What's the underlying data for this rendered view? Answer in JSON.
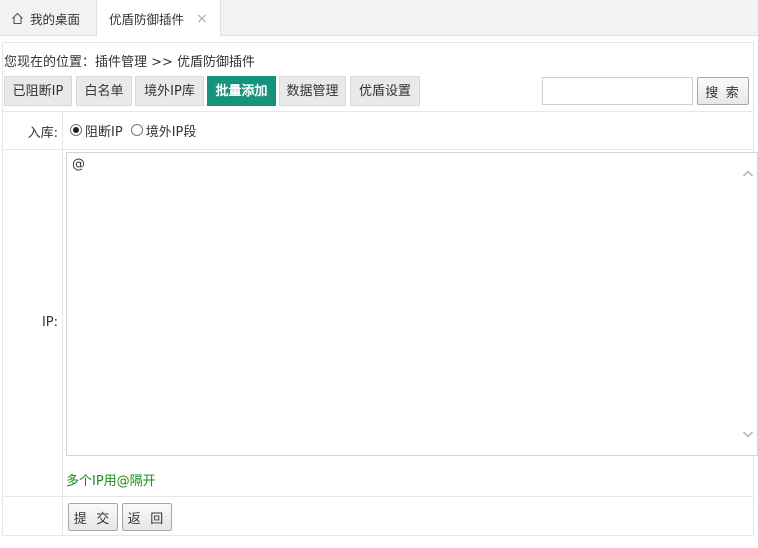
{
  "tabs": [
    {
      "label": "我的桌面",
      "icon": "home-icon"
    },
    {
      "label": "优盾防御插件",
      "close": "×"
    }
  ],
  "breadcrumb": "您现在的位置：插件管理 >> 优盾防御插件",
  "toolbar": {
    "buttons": [
      {
        "label": "已阻断IP"
      },
      {
        "label": "白名单"
      },
      {
        "label": "境外IP库"
      },
      {
        "label": "批量添加",
        "active": true
      },
      {
        "label": "数据管理"
      },
      {
        "label": "优盾设置"
      }
    ],
    "search_value": "",
    "search_label": "搜 索"
  },
  "form": {
    "storage_label": "入库:",
    "radio_options": [
      {
        "label": "阻断IP",
        "checked": true
      },
      {
        "label": "境外IP段",
        "checked": false
      }
    ],
    "ip_label": "IP:",
    "ip_value": "@",
    "hint": "多个IP用@隔开",
    "submit_label": "提 交",
    "back_label": "返 回"
  },
  "colors": {
    "active_tab_button": "#16927d",
    "hint_text": "#1a8a1a"
  }
}
